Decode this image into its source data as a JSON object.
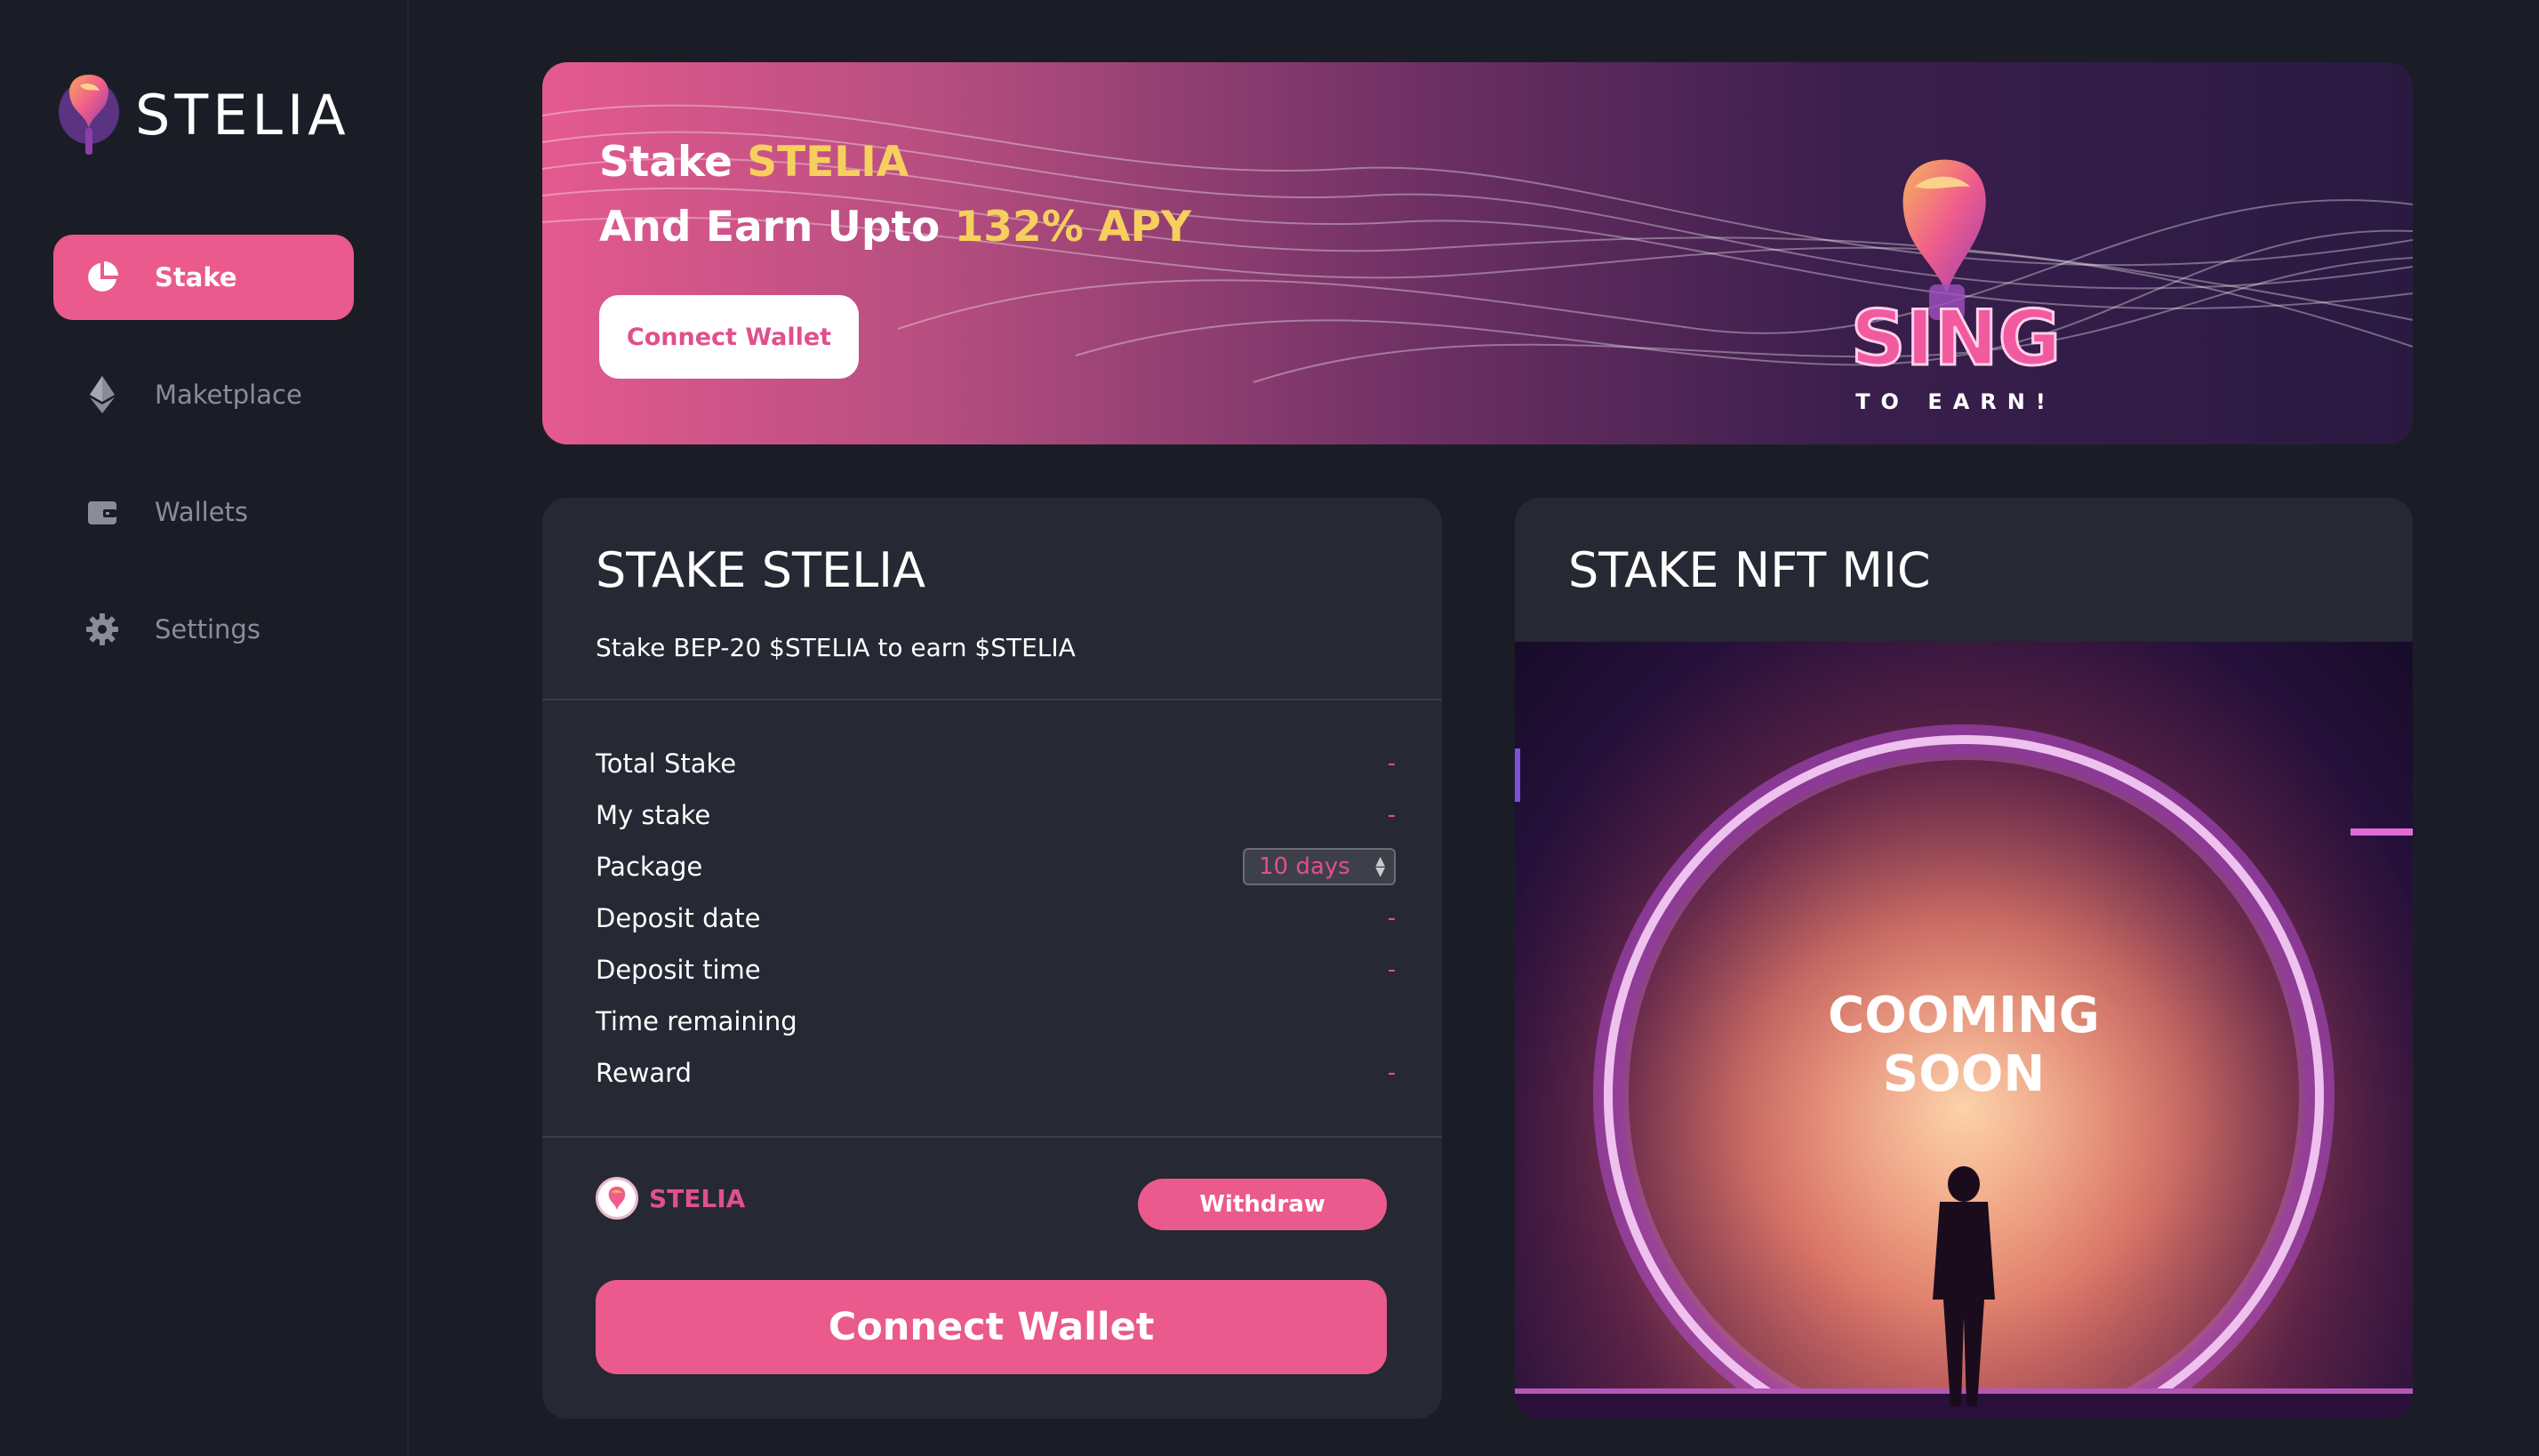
{
  "brand": {
    "name": "STELIA"
  },
  "sidebar": {
    "items": [
      {
        "label": "Stake",
        "icon": "pie-chart-icon",
        "active": true
      },
      {
        "label": "Maketplace",
        "icon": "ethereum-icon",
        "active": false
      },
      {
        "label": "Wallets",
        "icon": "wallet-icon",
        "active": false
      },
      {
        "label": "Settings",
        "icon": "gear-icon",
        "active": false
      }
    ]
  },
  "banner": {
    "line1_prefix": "Stake ",
    "line1_highlight": "STELIA",
    "line2_prefix": "And Earn Upto ",
    "line2_highlight": "132% APY",
    "button_label": "Connect Wallet",
    "art_main": "SING",
    "art_sub": "TO EARN!"
  },
  "stake_card": {
    "title": "STAKE STELIA",
    "subtitle": "Stake BEP-20 $STELIA to earn $STELIA",
    "rows": [
      {
        "label": "Total Stake",
        "value": "-"
      },
      {
        "label": "My stake",
        "value": "-"
      },
      {
        "label": "Package",
        "value": "10 days"
      },
      {
        "label": "Deposit date",
        "value": "-"
      },
      {
        "label": "Deposit time",
        "value": "-"
      },
      {
        "label": "Time remaining",
        "value": ""
      },
      {
        "label": "Reward",
        "value": "-"
      }
    ],
    "token_name": "STELIA",
    "withdraw_label": "Withdraw",
    "connect_label": "Connect Wallet"
  },
  "nft_card": {
    "title": "STAKE NFT MIC",
    "status_line1": "COOMING",
    "status_line2": "SOON"
  },
  "colors": {
    "accent": "#ea5a8c",
    "highlight": "#f7cf5e",
    "background": "#1b1d26",
    "card": "#262833"
  }
}
